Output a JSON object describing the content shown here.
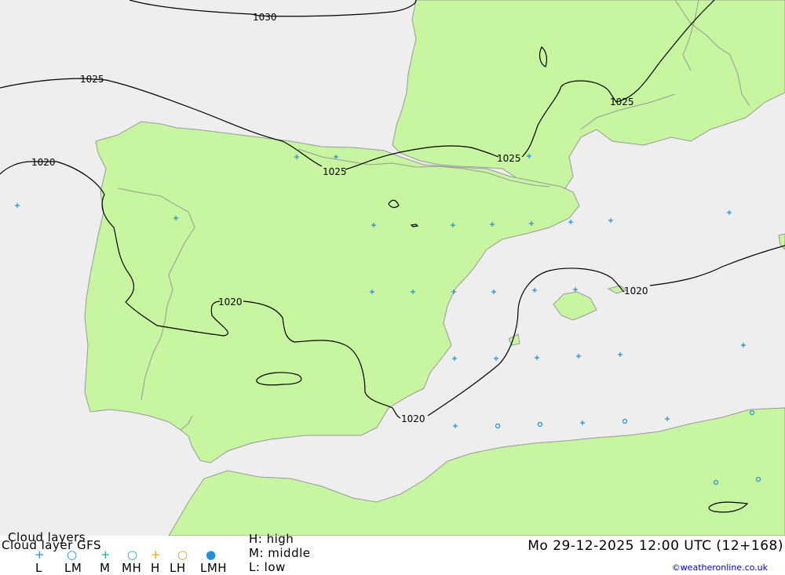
{
  "legend": {
    "title": "Cloud layers",
    "model": "Cloud layer   GFS",
    "codes": [
      "L",
      "LM",
      "M",
      "MH",
      "H",
      "LH",
      "LMH"
    ],
    "key_high": "H:  high",
    "key_middle": "M:  middle",
    "key_low": "L:  low",
    "datetime": "Mo 29-12-2025 12:00 UTC (12+168)",
    "credit": "©weatheronline.co.uk"
  },
  "isobars": {
    "labels": [
      "1030",
      "1025",
      "1025",
      "1025",
      "1025",
      "1020",
      "1020",
      "1020",
      "1020"
    ]
  },
  "colors": {
    "land": "#c8f5a0",
    "sea": "#eeeeee",
    "isobar": "#000000",
    "symbol_blue": "#1f8fe0",
    "symbol_orange": "#f0a020",
    "border": "#999999"
  },
  "symbols": {
    "plus_count": 28,
    "circle_count": 6
  }
}
